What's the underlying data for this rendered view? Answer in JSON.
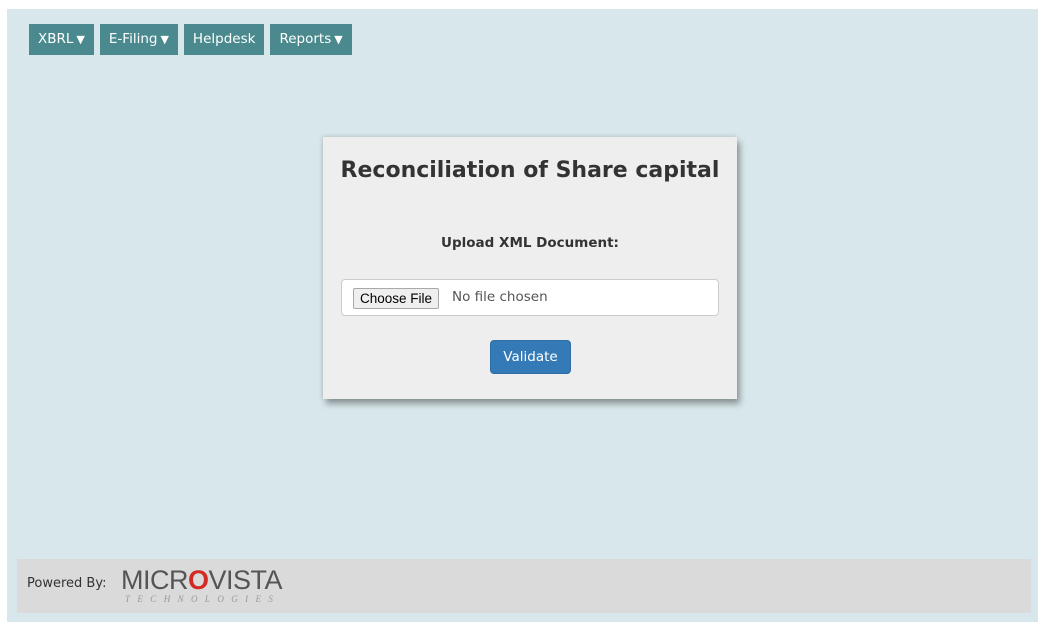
{
  "nav": {
    "items": [
      {
        "label": "XBRL",
        "dropdown": true
      },
      {
        "label": "E-Filing",
        "dropdown": true
      },
      {
        "label": "Helpdesk",
        "dropdown": false
      },
      {
        "label": "Reports",
        "dropdown": true
      }
    ],
    "caret": "▼"
  },
  "card": {
    "title": "Reconciliation of Share capital",
    "upload_label": "Upload XML Document:",
    "file_button": "Choose File",
    "file_status": "No file chosen",
    "validate_button": "Validate"
  },
  "footer": {
    "powered_by": "Powered By:",
    "logo": {
      "micr": "MICR",
      "o": "O",
      "vista": "VISTA",
      "sub": "TECHNOLOGIES"
    }
  },
  "colors": {
    "page_bg": "#d8e7eb",
    "nav_bg": "#4a8a8e",
    "card_bg": "#eeeeee",
    "primary": "#337ab7",
    "footer_bg": "#dadada",
    "logo_accent": "#d42a25"
  }
}
